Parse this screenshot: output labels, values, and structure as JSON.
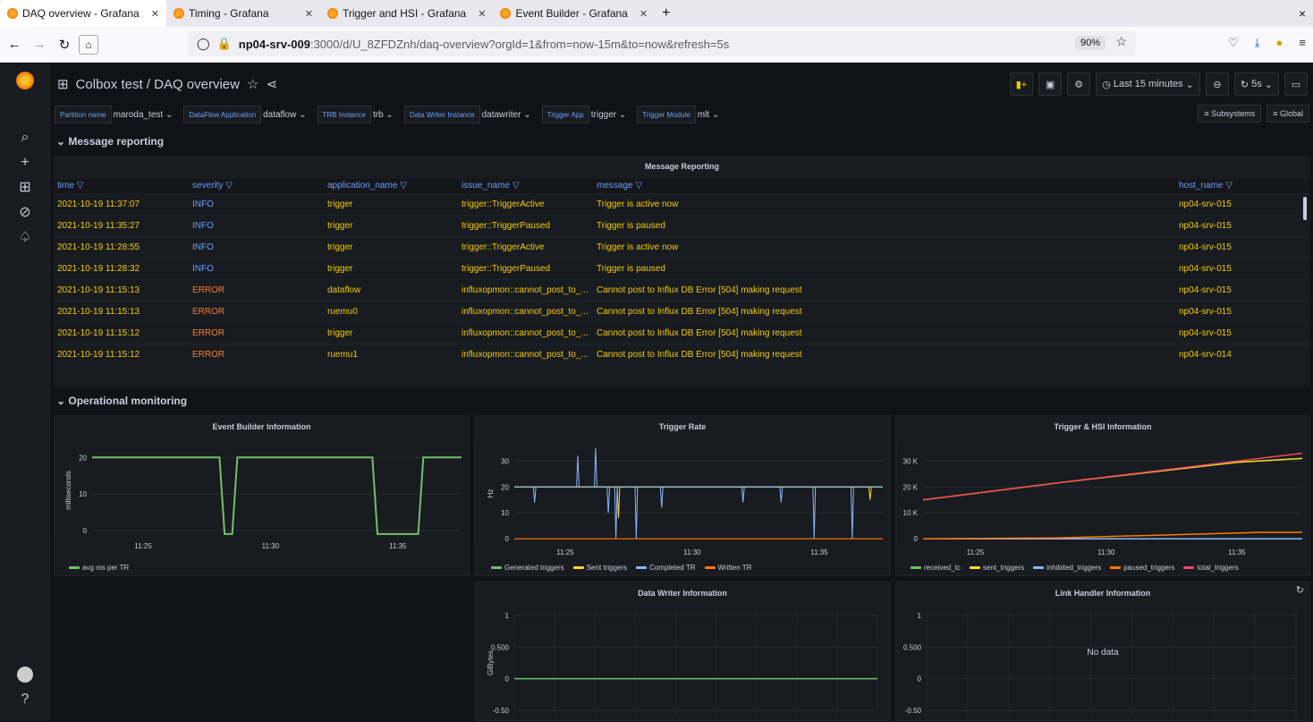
{
  "browser": {
    "tabs": [
      {
        "label": "DAQ overview - Grafana",
        "active": true
      },
      {
        "label": "Timing - Grafana",
        "active": false
      },
      {
        "label": "Trigger and HSI - Grafana",
        "active": false
      },
      {
        "label": "Event Builder - Grafana",
        "active": false
      }
    ],
    "new_tab": "+",
    "close_window": "×",
    "url_host": "np04-srv-009",
    "url_rest": ":3000/d/U_8ZFDZnh/daq-overview?orgId=1&from=now-15m&to=now&refresh=5s",
    "zoom": "90%"
  },
  "dashboard": {
    "breadcrumb": "Colbox test / DAQ overview",
    "time_range": "Last 15 minutes",
    "refresh": "5s"
  },
  "variables": [
    {
      "label": "Partition name",
      "value": "maroda_test"
    },
    {
      "label": "DataFlow Application",
      "value": "dataflow"
    },
    {
      "label": "TRB Instance",
      "value": "trb"
    },
    {
      "label": "Data Writer Instance",
      "value": "datawriter"
    },
    {
      "label": "Trigger App",
      "value": "trigger"
    },
    {
      "label": "Trigger Module",
      "value": "mlt"
    }
  ],
  "links": {
    "subsystems": "Subsystems",
    "global": "Global"
  },
  "rows": {
    "message_reporting": "Message reporting",
    "operational_monitoring": "Operational monitoring"
  },
  "message_table": {
    "title": "Message Reporting",
    "columns": [
      "time",
      "severity",
      "application_name",
      "issue_name",
      "message",
      "host_name"
    ],
    "rows": [
      [
        "2021-10-19 11:37:07",
        "INFO",
        "trigger",
        "trigger::TriggerActive",
        "Trigger is active now",
        "np04-srv-015"
      ],
      [
        "2021-10-19 11:35:27",
        "INFO",
        "trigger",
        "trigger::TriggerPaused",
        "Trigger is paused",
        "np04-srv-015"
      ],
      [
        "2021-10-19 11:28:55",
        "INFO",
        "trigger",
        "trigger::TriggerActive",
        "Trigger is active now",
        "np04-srv-015"
      ],
      [
        "2021-10-19 11:28:32",
        "INFO",
        "trigger",
        "trigger::TriggerPaused",
        "Trigger is paused",
        "np04-srv-015"
      ],
      [
        "2021-10-19 11:15:13",
        "ERROR",
        "dataflow",
        "influxopmon::cannot_post_to_...",
        "Cannot post to Influx DB Error [504] making request",
        "np04-srv-015"
      ],
      [
        "2021-10-19 11:15:13",
        "ERROR",
        "ruemu0",
        "influxopmon::cannot_post_to_...",
        "Cannot post to Influx DB Error [504] making request",
        "np04-srv-015"
      ],
      [
        "2021-10-19 11:15:12",
        "ERROR",
        "trigger",
        "influxopmon::cannot_post_to_...",
        "Cannot post to Influx DB Error [504] making request",
        "np04-srv-015"
      ],
      [
        "2021-10-19 11:15:12",
        "ERROR",
        "ruemu1",
        "influxopmon::cannot_post_to_...",
        "Cannot post to Influx DB Error [504] making request",
        "np04-srv-014"
      ]
    ]
  },
  "colors": {
    "info": "#6e9fff",
    "error": "#ff7f2a",
    "text_yellow": "#f2cc0c",
    "green": "#73bf69",
    "yellow": "#fade2a",
    "blue": "#8ab8ff",
    "orange": "#ff780a",
    "red": "#f2495c"
  },
  "panels": {
    "event_builder": "Event Builder Information",
    "trigger_rate": "Trigger Rate",
    "trigger_hsi": "Trigger & HSI Information",
    "data_writer": "Data Writer Information",
    "link_handler": "Link Handler Information",
    "no_data": "No data"
  },
  "chart_data": [
    {
      "type": "line",
      "title": "Event Builder Information",
      "ylabel": "milliseconds",
      "ylim": [
        -2,
        24
      ],
      "yticks": [
        "20",
        "10",
        "0"
      ],
      "xticks": [
        "11:25",
        "11:30",
        "11:35"
      ],
      "series": [
        {
          "name": "avg ms per TR",
          "color": "#73bf69",
          "x": [
            "11:23",
            "11:28",
            "11:28.2",
            "11:28.5",
            "11:28.7",
            "11:34",
            "11:34.2",
            "11:35.8",
            "11:36",
            "11:37.5"
          ],
          "y": [
            20,
            20,
            -1,
            -1,
            20,
            20,
            -1,
            -1,
            20,
            20
          ]
        }
      ]
    },
    {
      "type": "line",
      "title": "Trigger Rate",
      "ylabel": "Hz",
      "ylim": [
        -2,
        37
      ],
      "yticks": [
        "30",
        "20",
        "10",
        "0"
      ],
      "xticks": [
        "11:25",
        "11:30",
        "11:35"
      ],
      "series": [
        {
          "name": "Generated triggers",
          "color": "#73bf69",
          "x": [
            "11:23",
            "11:37.5"
          ],
          "y": [
            20,
            20
          ]
        },
        {
          "name": "Sent triggers",
          "color": "#fade2a",
          "x": [
            "11:23",
            "11:37.5"
          ],
          "y": [
            20,
            20
          ]
        },
        {
          "name": "Completed TR",
          "color": "#8ab8ff",
          "x": [
            "11:23",
            "11:37.5"
          ],
          "y": [
            20,
            20
          ]
        },
        {
          "name": "Written TR",
          "color": "#ff780a",
          "x": [
            "11:23",
            "11:37.5"
          ],
          "y": [
            0,
            0
          ]
        }
      ]
    },
    {
      "type": "line",
      "title": "Trigger & HSI Information",
      "ylim": [
        -2000,
        37000
      ],
      "yticks": [
        "30 K",
        "20 K",
        "10 K",
        "0"
      ],
      "xticks": [
        "11:25",
        "11:30",
        "11:35"
      ],
      "series": [
        {
          "name": "received_tc",
          "color": "#73bf69",
          "x": [
            "11:23",
            "11:37.5"
          ],
          "y": [
            0,
            0
          ]
        },
        {
          "name": "sent_triggers",
          "color": "#fade2a",
          "x": [
            "11:23",
            "11:28.5",
            "11:35",
            "11:37.5"
          ],
          "y": [
            15000,
            22000,
            29500,
            31000
          ]
        },
        {
          "name": "inhibited_triggers",
          "color": "#8ab8ff",
          "x": [
            "11:23",
            "11:37.5"
          ],
          "y": [
            0,
            0
          ]
        },
        {
          "name": "paused_triggers",
          "color": "#ff780a",
          "x": [
            "11:23",
            "11:28",
            "11:36",
            "11:37.5"
          ],
          "y": [
            0,
            300,
            2500,
            2500
          ]
        },
        {
          "name": "total_triggers",
          "color": "#f2495c",
          "x": [
            "11:23",
            "11:28.5",
            "11:37.5"
          ],
          "y": [
            15000,
            22000,
            33000
          ]
        }
      ]
    },
    {
      "type": "line",
      "title": "Data Writer Information",
      "ylabel": "GiBytes",
      "ylim": [
        -0.6,
        1.1
      ],
      "yticks": [
        "1",
        "0.500",
        "0",
        "-0.50"
      ],
      "series": [
        {
          "color": "#73bf69",
          "x": [
            "start",
            "end"
          ],
          "y": [
            0,
            0
          ]
        }
      ]
    },
    {
      "type": "line",
      "title": "Link Handler Information",
      "ylim": [
        -0.6,
        1.1
      ],
      "yticks": [
        "1",
        "0.500",
        "0",
        "-0.50"
      ],
      "series": []
    }
  ]
}
